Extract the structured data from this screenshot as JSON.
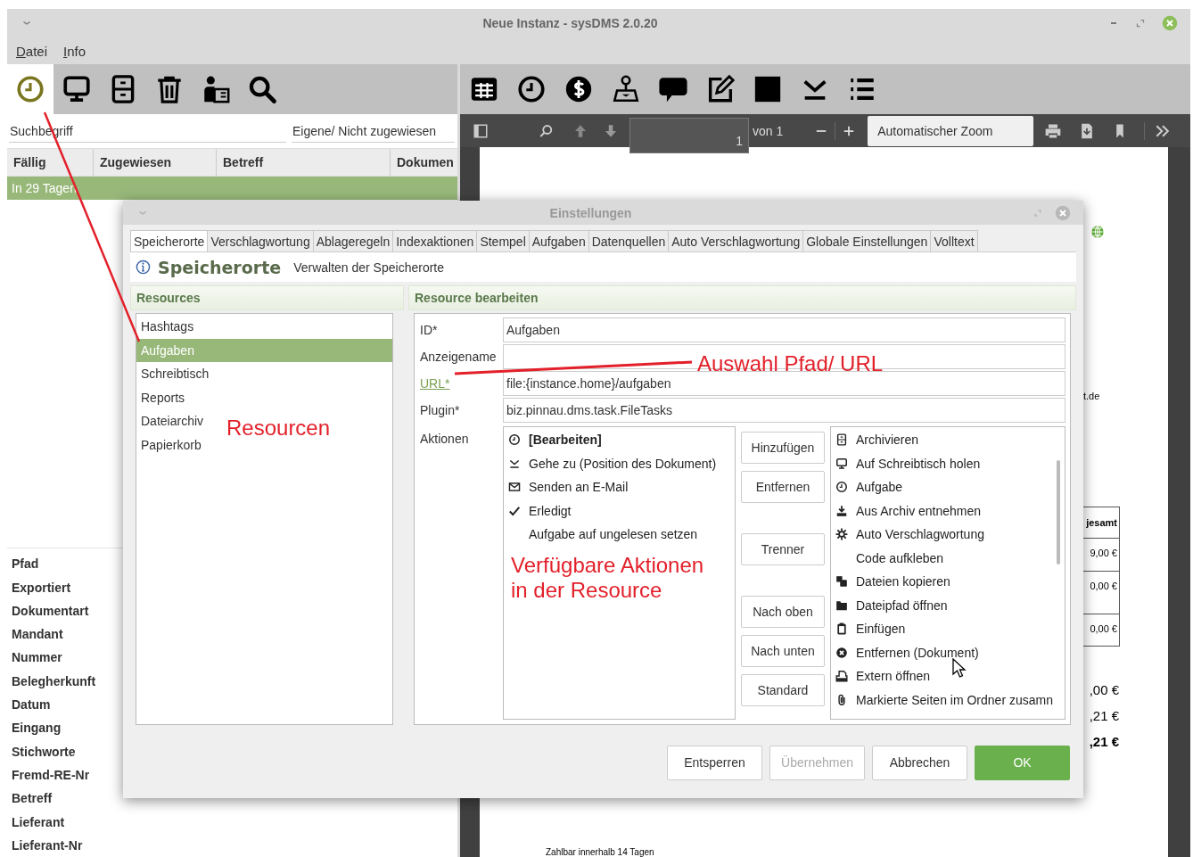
{
  "window": {
    "title": "Neue Instanz - sysDMS 2.0.20"
  },
  "menu": [
    "Datei",
    "Info"
  ],
  "task_toolbar": [
    {
      "kind": "clock",
      "selected": true
    },
    {
      "kind": "monitor",
      "selected": false
    },
    {
      "kind": "cabinet",
      "selected": false
    },
    {
      "kind": "trash",
      "selected": false
    },
    {
      "kind": "person-card",
      "selected": false
    },
    {
      "kind": "search",
      "selected": false
    }
  ],
  "search": {
    "placeholder": "Suchbegriff"
  },
  "filter": {
    "value": "Eigene/ Nicht zugewiesen"
  },
  "task_table": {
    "columns": [
      "Fällig",
      "Zugewiesen",
      "Betreff",
      "Dokumen"
    ],
    "rows": [
      {
        "cells": [
          "In 29 Tagen"
        ],
        "selected": true
      }
    ]
  },
  "fields": [
    "Pfad",
    "Exportiert",
    "Dokumentart",
    "Mandant",
    "Nummer",
    "Belegherkunft",
    "Datum",
    "Eingang",
    "Stichworte",
    "Fremd-RE-Nr",
    "Betreff",
    "Lieferant",
    "Lieferant-Nr"
  ],
  "viewer_toolbar": [
    {
      "kind": "grid"
    },
    {
      "kind": "clock"
    },
    {
      "kind": "coin"
    },
    {
      "kind": "stamp"
    },
    {
      "kind": "speech"
    },
    {
      "kind": "edit"
    },
    {
      "kind": "square"
    },
    {
      "kind": "goto"
    },
    {
      "kind": "list"
    }
  ],
  "pdf_toolbar": {
    "page": "1",
    "page_count": "von 1",
    "zoom": "Automatischer Zoom"
  },
  "document": {
    "contact": "t.de",
    "table": {
      "header": "jesamt",
      "cells": [
        "9,00 €",
        "0,00 €",
        "0,00 €"
      ]
    },
    "totals": [
      {
        "text": ",00 €",
        "bold": false
      },
      {
        "text": ",21 €",
        "bold": false
      },
      {
        "text": ",21 €",
        "bold": true
      }
    ],
    "footer": "Zahlbar innerhalb 14 Tagen"
  },
  "dialog": {
    "title": "Einstellungen",
    "tabs": [
      {
        "label": "Speicherorte",
        "selected": true
      },
      {
        "label": "Verschlagwortung",
        "selected": false
      },
      {
        "label": "Ablageregeln",
        "selected": false
      },
      {
        "label": "Indexaktionen",
        "selected": false
      },
      {
        "label": "Stempel",
        "selected": false
      },
      {
        "label": "Aufgaben",
        "selected": false
      },
      {
        "label": "Datenquellen",
        "selected": false
      },
      {
        "label": "Auto Verschlagwortung",
        "selected": false
      },
      {
        "label": "Globale Einstellungen",
        "selected": false
      },
      {
        "label": "Volltext",
        "selected": false
      }
    ],
    "heading": "Speicherorte",
    "subheading": "Verwalten der Speicherorte",
    "resources": {
      "title": "Resources",
      "items": [
        {
          "label": "Hashtags",
          "selected": false
        },
        {
          "label": "Aufgaben",
          "selected": true
        },
        {
          "label": "Schreibtisch",
          "selected": false
        },
        {
          "label": "Reports",
          "selected": false
        },
        {
          "label": "Dateiarchiv",
          "selected": false
        },
        {
          "label": "Papierkorb",
          "selected": false
        }
      ]
    },
    "editor": {
      "title": "Resource bearbeiten",
      "fields": [
        {
          "label": "ID*",
          "kind": "text",
          "value": "Aufgaben"
        },
        {
          "label": "Anzeigename",
          "kind": "text"
        },
        {
          "label": "URL*",
          "kind": "link",
          "value": "file:{instance.home}/aufgaben"
        },
        {
          "label": "Plugin*",
          "kind": "text",
          "value": "biz.pinnau.dms.task.FileTasks"
        }
      ],
      "actions_label": "Aktionen",
      "assigned_actions": [
        {
          "label": "[Bearbeiten]",
          "kind": "clock",
          "default": true
        },
        {
          "label": "Gehe zu (Position des Dokument)",
          "kind": "goto",
          "default": false
        },
        {
          "label": "Senden an E-Mail",
          "kind": "mail",
          "default": false
        },
        {
          "label": "Erledigt",
          "kind": "check",
          "default": false
        },
        {
          "label": "Aufgabe auf ungelesen setzen",
          "kind": "none",
          "default": false
        }
      ],
      "action_button_groups": [
        [
          "Hinzufügen",
          "Entfernen"
        ],
        [
          "Trenner"
        ],
        [
          "Nach oben",
          "Nach unten",
          "Standard"
        ]
      ],
      "available_actions": [
        {
          "label": "Archivieren",
          "kind": "cabinet"
        },
        {
          "label": "Auf Schreibtisch holen",
          "kind": "monitor"
        },
        {
          "label": "Aufgabe",
          "kind": "clock"
        },
        {
          "label": "Aus Archiv entnehmen",
          "kind": "download"
        },
        {
          "label": "Auto Verschlagwortung",
          "kind": "gear"
        },
        {
          "label": "Code aufkleben",
          "kind": "none"
        },
        {
          "label": "Dateien kopieren",
          "kind": "copy"
        },
        {
          "label": "Dateipfad öffnen",
          "kind": "folder"
        },
        {
          "label": "Einfügen",
          "kind": "clipboard"
        },
        {
          "label": "Entfernen (Dokument)",
          "kind": "xcircle"
        },
        {
          "label": "Extern öffnen",
          "kind": "extern"
        },
        {
          "label": "Markierte Seiten im Ordner zusamn",
          "kind": "clip"
        }
      ]
    },
    "buttons": [
      {
        "label": "Entsperren",
        "disabled": false,
        "default": false
      },
      {
        "label": "Übernehmen",
        "disabled": true,
        "default": false
      },
      {
        "label": "Abbrechen",
        "disabled": false,
        "default": false
      },
      {
        "label": "OK",
        "disabled": false,
        "default": true
      }
    ]
  },
  "annotations": [
    {
      "text": "Auswahl Pfad/ URL"
    },
    {
      "text": "Resourcen"
    },
    {
      "text": "Verfügbare Aktionen in der Resource"
    }
  ]
}
